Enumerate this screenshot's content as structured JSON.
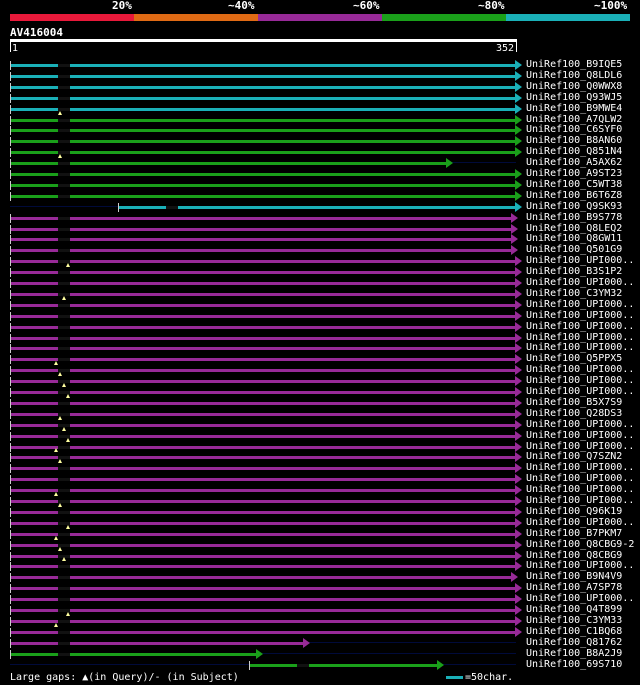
{
  "scale": {
    "labels": [
      "20%",
      "~40%",
      "~60%",
      "~80%",
      "~100%"
    ],
    "colors": [
      "#e8193a",
      "#e06a14",
      "#982a98",
      "#1aa01a",
      "#1ab0b8"
    ]
  },
  "query": {
    "name": "AV416004",
    "start": "1",
    "end": "352"
  },
  "hits": [
    {
      "name": "UniRef100_B9IQE5",
      "color": "#1ab0b8",
      "from": 1,
      "to": 352,
      "gap": null
    },
    {
      "name": "UniRef100_Q8LDL6",
      "color": "#1ab0b8",
      "from": 1,
      "to": 352,
      "gap": null
    },
    {
      "name": "UniRef100_Q0WWX8",
      "color": "#1ab0b8",
      "from": 1,
      "to": 352,
      "gap": null
    },
    {
      "name": "UniRef100_Q93WJ5",
      "color": "#1ab0b8",
      "from": 1,
      "to": 352,
      "gap": null
    },
    {
      "name": "UniRef100_B9MWE4",
      "color": "#1ab0b8",
      "from": 1,
      "to": 352,
      "gap": null
    },
    {
      "name": "UniRef100_A7QLW2",
      "color": "#1aa01a",
      "from": 1,
      "to": 352,
      "gap": "query"
    },
    {
      "name": "UniRef100_C6SYF0",
      "color": "#1aa01a",
      "from": 1,
      "to": 352,
      "gap": null
    },
    {
      "name": "UniRef100_B8AN60",
      "color": "#1aa01a",
      "from": 1,
      "to": 352,
      "gap": null
    },
    {
      "name": "UniRef100_Q851N4",
      "color": "#1aa01a",
      "from": 1,
      "to": 352,
      "gap": null
    },
    {
      "name": "UniRef100_A5AX62",
      "color": "#1aa01a",
      "from": 1,
      "to": 304,
      "gap": "query"
    },
    {
      "name": "UniRef100_A9ST23",
      "color": "#1aa01a",
      "from": 1,
      "to": 352,
      "gap": null
    },
    {
      "name": "UniRef100_C5WT38",
      "color": "#1aa01a",
      "from": 1,
      "to": 352,
      "gap": null
    },
    {
      "name": "UniRef100_B6T6Z8",
      "color": "#1aa01a",
      "from": 1,
      "to": 352,
      "gap": null
    },
    {
      "name": "UniRef100_Q9SK93",
      "color": "#1ab0b8",
      "from": 76,
      "to": 352,
      "gap": null
    },
    {
      "name": "UniRef100_B9S778",
      "color": "#982a98",
      "from": 1,
      "to": 349,
      "gap": null
    },
    {
      "name": "UniRef100_Q8LEQ2",
      "color": "#982a98",
      "from": 1,
      "to": 349,
      "gap": null
    },
    {
      "name": "UniRef100_Q8GW11",
      "color": "#982a98",
      "from": 1,
      "to": 349,
      "gap": null
    },
    {
      "name": "UniRef100_Q501G9",
      "color": "#982a98",
      "from": 1,
      "to": 349,
      "gap": null
    },
    {
      "name": "UniRef100_UPI000..",
      "color": "#982a98",
      "from": 1,
      "to": 352,
      "gap": null
    },
    {
      "name": "UniRef100_B3S1P2",
      "color": "#982a98",
      "from": 1,
      "to": 352,
      "gap": "query"
    },
    {
      "name": "UniRef100_UPI000..",
      "color": "#982a98",
      "from": 1,
      "to": 352,
      "gap": null
    },
    {
      "name": "UniRef100_C3YM32",
      "color": "#982a98",
      "from": 1,
      "to": 352,
      "gap": null
    },
    {
      "name": "UniRef100_UPI000..",
      "color": "#982a98",
      "from": 1,
      "to": 352,
      "gap": "query"
    },
    {
      "name": "UniRef100_UPI000..",
      "color": "#982a98",
      "from": 1,
      "to": 352,
      "gap": null
    },
    {
      "name": "UniRef100_UPI000..",
      "color": "#982a98",
      "from": 1,
      "to": 352,
      "gap": null
    },
    {
      "name": "UniRef100_UPI000..",
      "color": "#982a98",
      "from": 1,
      "to": 352,
      "gap": null
    },
    {
      "name": "UniRef100_UPI000..",
      "color": "#982a98",
      "from": 1,
      "to": 352,
      "gap": null
    },
    {
      "name": "UniRef100_Q5PPX5",
      "color": "#982a98",
      "from": 1,
      "to": 352,
      "gap": null
    },
    {
      "name": "UniRef100_UPI000..",
      "color": "#982a98",
      "from": 1,
      "to": 352,
      "gap": "query"
    },
    {
      "name": "UniRef100_UPI000..",
      "color": "#982a98",
      "from": 1,
      "to": 352,
      "gap": "query"
    },
    {
      "name": "UniRef100_UPI000..",
      "color": "#982a98",
      "from": 1,
      "to": 352,
      "gap": "query"
    },
    {
      "name": "UniRef100_B5X7S9",
      "color": "#982a98",
      "from": 1,
      "to": 352,
      "gap": "query"
    },
    {
      "name": "UniRef100_Q28DS3",
      "color": "#982a98",
      "from": 1,
      "to": 352,
      "gap": null
    },
    {
      "name": "UniRef100_UPI000..",
      "color": "#982a98",
      "from": 1,
      "to": 352,
      "gap": "query"
    },
    {
      "name": "UniRef100_UPI000..",
      "color": "#982a98",
      "from": 1,
      "to": 352,
      "gap": "query"
    },
    {
      "name": "UniRef100_UPI000..",
      "color": "#982a98",
      "from": 1,
      "to": 352,
      "gap": "query"
    },
    {
      "name": "UniRef100_Q7SZN2",
      "color": "#982a98",
      "from": 1,
      "to": 352,
      "gap": "query"
    },
    {
      "name": "UniRef100_UPI000..",
      "color": "#982a98",
      "from": 1,
      "to": 352,
      "gap": "query"
    },
    {
      "name": "UniRef100_UPI000..",
      "color": "#982a98",
      "from": 1,
      "to": 352,
      "gap": null
    },
    {
      "name": "UniRef100_UPI000..",
      "color": "#982a98",
      "from": 1,
      "to": 352,
      "gap": null
    },
    {
      "name": "UniRef100_UPI000..",
      "color": "#982a98",
      "from": 1,
      "to": 352,
      "gap": "query"
    },
    {
      "name": "UniRef100_Q96K19",
      "color": "#982a98",
      "from": 1,
      "to": 352,
      "gap": "query"
    },
    {
      "name": "UniRef100_UPI000..",
      "color": "#982a98",
      "from": 1,
      "to": 352,
      "gap": null
    },
    {
      "name": "UniRef100_B7PKM7",
      "color": "#982a98",
      "from": 1,
      "to": 352,
      "gap": "query"
    },
    {
      "name": "UniRef100_Q8CBG9-2",
      "color": "#982a98",
      "from": 1,
      "to": 352,
      "gap": "query"
    },
    {
      "name": "UniRef100_Q8CBG9",
      "color": "#982a98",
      "from": 1,
      "to": 352,
      "gap": "query"
    },
    {
      "name": "UniRef100_UPI000..",
      "color": "#982a98",
      "from": 1,
      "to": 352,
      "gap": "query"
    },
    {
      "name": "UniRef100_B9N4V9",
      "color": "#982a98",
      "from": 1,
      "to": 349,
      "gap": null
    },
    {
      "name": "UniRef100_A7SP78",
      "color": "#982a98",
      "from": 1,
      "to": 352,
      "gap": null
    },
    {
      "name": "UniRef100_UPI000..",
      "color": "#982a98",
      "from": 1,
      "to": 352,
      "gap": null
    },
    {
      "name": "UniRef100_Q4T899",
      "color": "#982a98",
      "from": 1,
      "to": 352,
      "gap": null
    },
    {
      "name": "UniRef100_C3YM33",
      "color": "#982a98",
      "from": 1,
      "to": 352,
      "gap": "query"
    },
    {
      "name": "UniRef100_C1BQ68",
      "color": "#982a98",
      "from": 1,
      "to": 352,
      "gap": "query"
    },
    {
      "name": "UniRef100_Q81762",
      "color": "#982a98",
      "from": 1,
      "to": 205,
      "gap": null
    },
    {
      "name": "UniRef100_B8A2J9",
      "color": "#1aa01a",
      "from": 1,
      "to": 172,
      "gap": null
    },
    {
      "name": "UniRef100_69S710",
      "color": "#1aa01a",
      "from": 167,
      "to": 298,
      "gap": null
    }
  ],
  "footer": {
    "legend": "Large gaps: ▲(in Query)/- (in Subject)",
    "scale_note": "=50char."
  }
}
